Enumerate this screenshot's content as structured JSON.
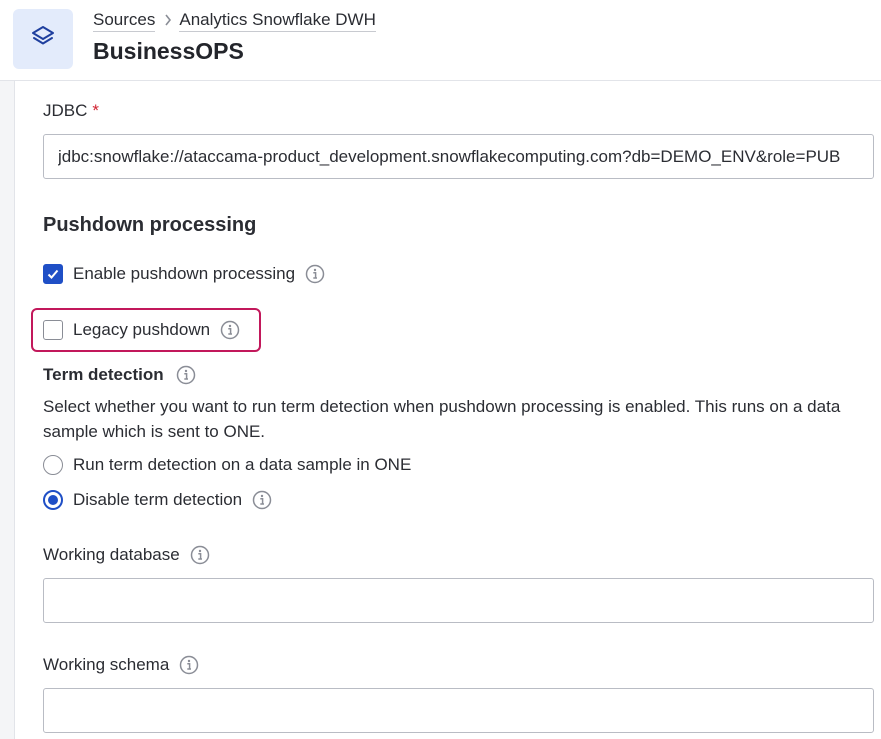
{
  "header": {
    "breadcrumb": [
      "Sources",
      "Analytics Snowflake DWH"
    ],
    "title": "BusinessOPS",
    "icon": "layers-icon"
  },
  "form": {
    "jdbc": {
      "label": "JDBC",
      "required_mark": "*",
      "value": "jdbc:snowflake://ataccama-product_development.snowflakecomputing.com?db=DEMO_ENV&role=PUB"
    },
    "pushdown": {
      "section_title": "Pushdown processing",
      "enable_label": "Enable pushdown processing",
      "enable_checked": true,
      "legacy_label": "Legacy pushdown",
      "legacy_checked": false
    },
    "term_detection": {
      "title": "Term detection",
      "description": "Select whether you want to run term detection when pushdown processing is enabled. This runs on a data sample which is sent to ONE.",
      "options": [
        {
          "label": "Run term detection on a data sample in ONE",
          "selected": false
        },
        {
          "label": "Disable term detection",
          "selected": true
        }
      ]
    },
    "working_database": {
      "label": "Working database",
      "value": ""
    },
    "working_schema": {
      "label": "Working schema",
      "value": ""
    }
  },
  "colors": {
    "accent": "#1f4fc6",
    "highlight": "#c2185b",
    "icon_box": "#e3ebfb",
    "required": "#d0212f"
  }
}
